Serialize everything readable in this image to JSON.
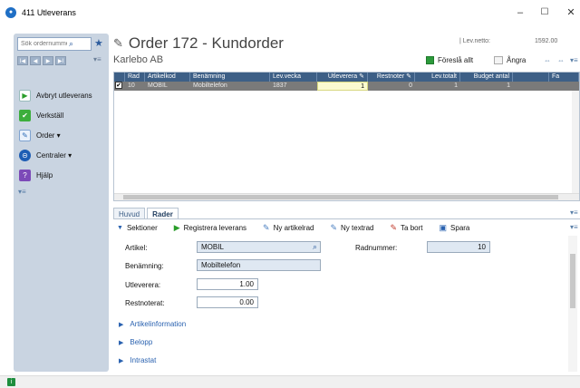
{
  "window": {
    "title": "411 Utleverans",
    "minimize": "–",
    "maximize": "☐",
    "close": "✕"
  },
  "sidebar": {
    "search_placeholder": "Sök ordernummer",
    "nav": [
      "I◀",
      "◀",
      "▶",
      "▶I"
    ],
    "items": [
      {
        "label": "Avbryt utleverans",
        "icon": "play-icon",
        "color": "#ffffff"
      },
      {
        "label": "Verkställ",
        "icon": "check-icon",
        "color": "#3cae3c"
      },
      {
        "label": "Order ▾",
        "icon": "order-icon",
        "color": "#2f6db7"
      },
      {
        "label": "Centraler ▾",
        "icon": "centraler-icon",
        "color": "#1d5db4"
      },
      {
        "label": "Hjälp",
        "icon": "help-icon",
        "color": "#7c4ab8"
      }
    ]
  },
  "header": {
    "title": "Order 172 - Kundorder",
    "customer": "Karlebo AB",
    "lev_netto_label": "| Lev.netto:",
    "lev_netto_value": "1592.00",
    "foresla_allt": "Föreslå allt",
    "angra": "Ångra"
  },
  "grid": {
    "columns": [
      "Rad",
      "Artikelkod",
      "Benämning",
      "Lev.vecka",
      "Utleverera",
      "Restnoter",
      "Lev.totalt",
      "Budget antal",
      "",
      "Fa"
    ],
    "rows": [
      {
        "checked": "✔",
        "rad": "10",
        "artikelkod": "MOBIL",
        "benamning": "Mobiltelefon",
        "levvecka": "1837",
        "utleverera": "1",
        "restnoter": "0",
        "levtotalt": "1",
        "budget": "1"
      }
    ]
  },
  "tabs": [
    "Huvud",
    "Rader"
  ],
  "subtoolbar": {
    "sektioner": "Sektioner",
    "registrera": "Registrera leverans",
    "ny_artikelrad": "Ny artikelrad",
    "ny_textrad": "Ny textrad",
    "ta_bort": "Ta bort",
    "spara": "Spara"
  },
  "detail": {
    "artikel_label": "Artikel:",
    "artikel_value": "MOBIL",
    "radnummer_label": "Radnummer:",
    "radnummer_value": "10",
    "benamning_label": "Benämning:",
    "benamning_value": "Mobiltelefon",
    "utleverera_label": "Utleverera:",
    "utleverera_value": "1.00",
    "restnoterat_label": "Restnoterat:",
    "restnoterat_value": "0.00",
    "sections": [
      "Artikelinformation",
      "Belopp",
      "Intrastat"
    ]
  }
}
